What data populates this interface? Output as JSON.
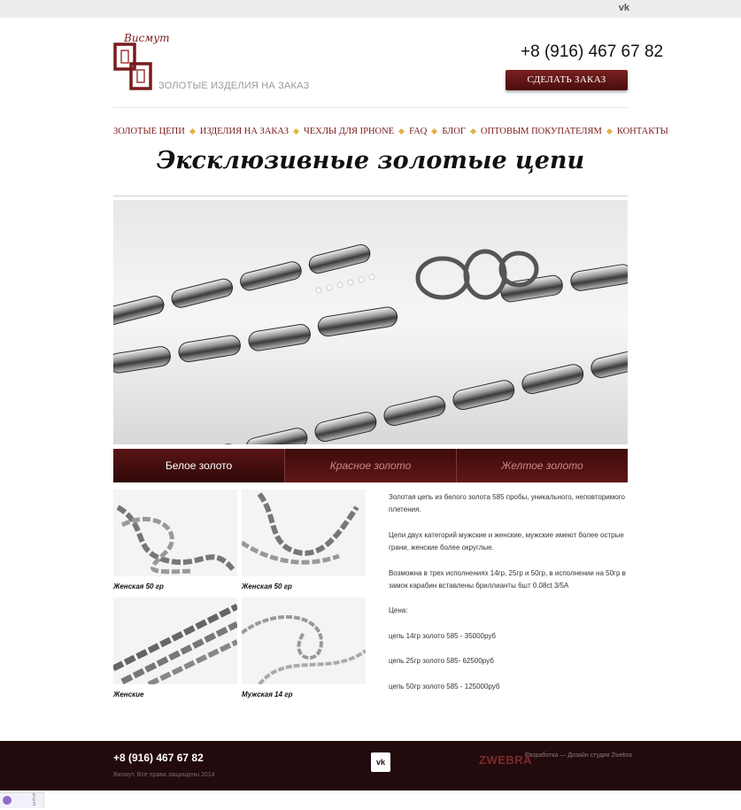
{
  "topbar": {
    "social": "vk"
  },
  "header": {
    "logo_script": "Висмут",
    "tagline": "ЗОЛОТЫЕ ИЗДЕЛИЯ НА ЗАКАЗ",
    "phone": "+8 (916) 467 67 82",
    "order_button": "СДЕЛАТЬ ЗАКАЗ"
  },
  "nav": {
    "items": [
      "ЗОЛОТЫЕ ЦЕПИ",
      "ИЗДЕЛИЯ НА ЗАКАЗ",
      "ЧЕХЛЫ ДЛЯ IPHONE",
      "FAQ",
      "БЛОГ",
      "ОПТОВЫМ ПОКУПАТЕЛЯМ",
      "КОНТАКТЫ"
    ]
  },
  "page": {
    "title": "Эксклюзивные золотые цепи"
  },
  "tabs": [
    {
      "label": "Белое золото",
      "active": true
    },
    {
      "label": "Красное золото",
      "active": false
    },
    {
      "label": "Желтое золото",
      "active": false
    }
  ],
  "products": [
    {
      "caption": "Женская 50 гр"
    },
    {
      "caption": "Женская 50 гр"
    },
    {
      "caption": "Женские"
    },
    {
      "caption": "Мужская 14 гр"
    }
  ],
  "description": {
    "p1": "Золотая цепь из белого золота 585 пробы, уникального, неповторимого плетения.",
    "p2": "Цепи двух категорий мужские и женские, мужские имеют более острые грани, женские более округлые.",
    "p3": "Возможна в трех исполнениях 14гр, 25гр и 50гр, в исполнении на 50гр в замок карабин вставлены бриллианты 6шт 0.08ct 3/5A",
    "price_label": "Цена:",
    "price1": "цепь 14гр золото 585 - 35000руб",
    "price2": "цепь 25гр золото 585- 62500руб",
    "price3": "цепь 50гр золото 585 - 125000руб"
  },
  "footer": {
    "phone": "+8 (916) 467 67 82",
    "copyright": "Висмут. Все права защищены 2014",
    "social": "vk",
    "brand": "ZWEBRA",
    "developer": "Разработка — Дизайн студия Zwebra"
  },
  "colors": {
    "accent": "#5a1414",
    "footer_bg": "#230a0c",
    "nav_text": "#7a1a1a",
    "nav_separator": "#e0b340"
  }
}
